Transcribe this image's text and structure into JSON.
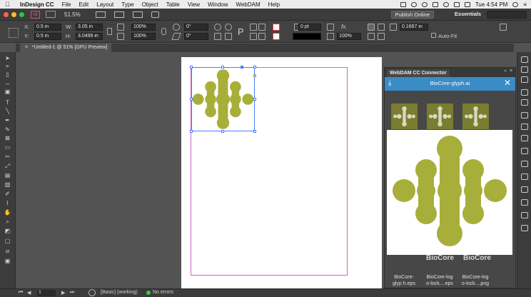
{
  "menubar": {
    "app": "InDesign CC",
    "items": [
      "File",
      "Edit",
      "Layout",
      "Type",
      "Object",
      "Table",
      "View",
      "Window",
      "WebDAM",
      "Help"
    ],
    "time": "Tue 4:54 PM"
  },
  "appbar": {
    "zoom": "51.5%",
    "publish": "Publish Online",
    "workspace": "Essentials",
    "search_placeholder": ""
  },
  "control": {
    "x_label": "X:",
    "x": "0.5 in",
    "y_label": "Y:",
    "y": "0.5 in",
    "w_label": "W:",
    "w": "3.05 in",
    "h_label": "H:",
    "h": "3.0499 in",
    "scale_x": "100%",
    "scale_y": "100%",
    "rotate": "0°",
    "shear": "0°",
    "stroke_weight": "0 pt",
    "opacity": "100%",
    "inset": "0.1667 in",
    "auto_fit": "Auto-Fit",
    "fx": "fx."
  },
  "document": {
    "tab": "*Untitled-1 @ 51% [GPU Preview]"
  },
  "panel": {
    "title": "WebDAM CC Connector",
    "file": "BioCore-glyph.ai",
    "brand": "BioCore",
    "files": [
      {
        "label": "BioCore-glyp h.eps"
      },
      {
        "label": "BioCore-log o-lock....eps"
      },
      {
        "label": "BioCore-log o-lock....png"
      }
    ],
    "accent": "#3a8cc6",
    "logo_color": "#a7af3a"
  },
  "status": {
    "page": "1",
    "style": "[Basic] (working)",
    "errors": "No errors"
  }
}
